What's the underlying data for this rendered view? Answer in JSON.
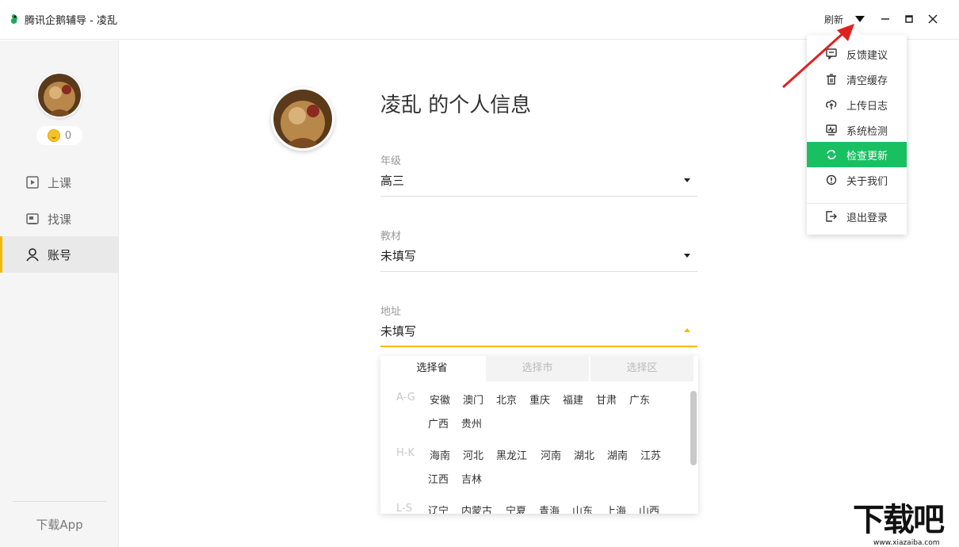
{
  "window": {
    "title": "腾讯企鹅辅导 - 凌乱",
    "refresh_label": "刷新"
  },
  "sidebar": {
    "coins": "0",
    "items": [
      {
        "label": "上课",
        "icon": "play-lesson-icon"
      },
      {
        "label": "找课",
        "icon": "course-search-icon"
      },
      {
        "label": "账号",
        "icon": "user-icon"
      }
    ],
    "download_label": "下载App",
    "accent_color": "#f5b800"
  },
  "profile": {
    "title": "凌乱 的个人信息",
    "fields": {
      "grade": {
        "label": "年级",
        "value": "高三"
      },
      "textbook": {
        "label": "教材",
        "value": "未填写"
      },
      "address": {
        "label": "地址",
        "value": "未填写"
      }
    }
  },
  "region_picker": {
    "tabs": [
      "选择省",
      "选择市",
      "选择区"
    ],
    "groups": [
      {
        "letters": "A-G",
        "provinces": [
          "安徽",
          "澳门",
          "北京",
          "重庆",
          "福建",
          "甘肃",
          "广东",
          "广西",
          "贵州"
        ]
      },
      {
        "letters": "H-K",
        "provinces": [
          "海南",
          "河北",
          "黑龙江",
          "河南",
          "湖北",
          "湖南",
          "江苏",
          "江西",
          "吉林"
        ]
      },
      {
        "letters": "L-S",
        "provinces": [
          "辽宁",
          "内蒙古",
          "宁夏",
          "青海",
          "山东",
          "上海",
          "山西"
        ]
      }
    ]
  },
  "menu": {
    "items": [
      {
        "label": "反馈建议",
        "icon": "feedback-icon"
      },
      {
        "label": "清空缓存",
        "icon": "trash-icon"
      },
      {
        "label": "上传日志",
        "icon": "upload-icon"
      },
      {
        "label": "系统检测",
        "icon": "system-check-icon"
      },
      {
        "label": "检查更新",
        "icon": "refresh-icon"
      },
      {
        "label": "关于我们",
        "icon": "info-icon"
      },
      {
        "label": "退出登录",
        "icon": "logout-icon"
      }
    ],
    "highlight_color": "#18c061"
  },
  "watermark": {
    "glyphs": "下载吧",
    "url": "www.xiazaiba.com"
  }
}
